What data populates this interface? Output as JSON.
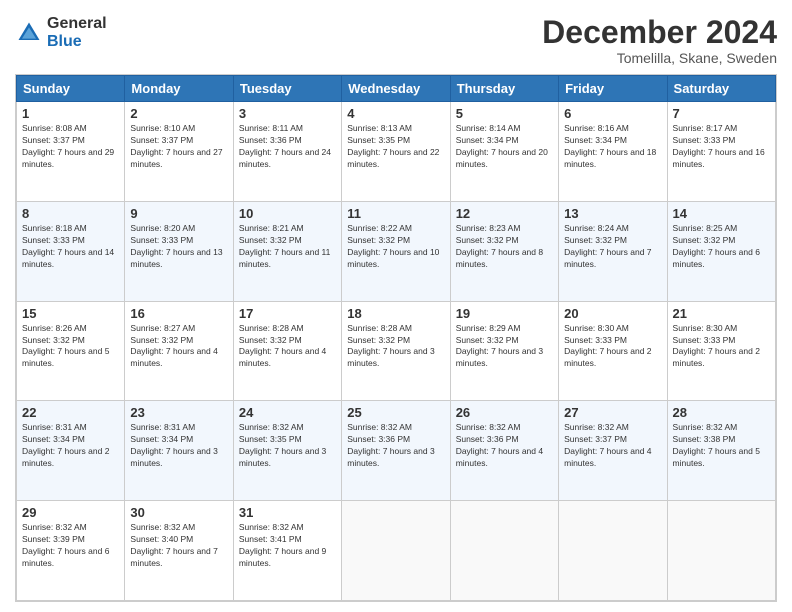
{
  "logo": {
    "general": "General",
    "blue": "Blue"
  },
  "title": "December 2024",
  "location": "Tomelilla, Skane, Sweden",
  "days_of_week": [
    "Sunday",
    "Monday",
    "Tuesday",
    "Wednesday",
    "Thursday",
    "Friday",
    "Saturday"
  ],
  "weeks": [
    [
      {
        "day": "1",
        "sunrise": "8:08 AM",
        "sunset": "3:37 PM",
        "daylight": "7 hours and 29 minutes."
      },
      {
        "day": "2",
        "sunrise": "8:10 AM",
        "sunset": "3:37 PM",
        "daylight": "7 hours and 27 minutes."
      },
      {
        "day": "3",
        "sunrise": "8:11 AM",
        "sunset": "3:36 PM",
        "daylight": "7 hours and 24 minutes."
      },
      {
        "day": "4",
        "sunrise": "8:13 AM",
        "sunset": "3:35 PM",
        "daylight": "7 hours and 22 minutes."
      },
      {
        "day": "5",
        "sunrise": "8:14 AM",
        "sunset": "3:34 PM",
        "daylight": "7 hours and 20 minutes."
      },
      {
        "day": "6",
        "sunrise": "8:16 AM",
        "sunset": "3:34 PM",
        "daylight": "7 hours and 18 minutes."
      },
      {
        "day": "7",
        "sunrise": "8:17 AM",
        "sunset": "3:33 PM",
        "daylight": "7 hours and 16 minutes."
      }
    ],
    [
      {
        "day": "8",
        "sunrise": "8:18 AM",
        "sunset": "3:33 PM",
        "daylight": "7 hours and 14 minutes."
      },
      {
        "day": "9",
        "sunrise": "8:20 AM",
        "sunset": "3:33 PM",
        "daylight": "7 hours and 13 minutes."
      },
      {
        "day": "10",
        "sunrise": "8:21 AM",
        "sunset": "3:32 PM",
        "daylight": "7 hours and 11 minutes."
      },
      {
        "day": "11",
        "sunrise": "8:22 AM",
        "sunset": "3:32 PM",
        "daylight": "7 hours and 10 minutes."
      },
      {
        "day": "12",
        "sunrise": "8:23 AM",
        "sunset": "3:32 PM",
        "daylight": "7 hours and 8 minutes."
      },
      {
        "day": "13",
        "sunrise": "8:24 AM",
        "sunset": "3:32 PM",
        "daylight": "7 hours and 7 minutes."
      },
      {
        "day": "14",
        "sunrise": "8:25 AM",
        "sunset": "3:32 PM",
        "daylight": "7 hours and 6 minutes."
      }
    ],
    [
      {
        "day": "15",
        "sunrise": "8:26 AM",
        "sunset": "3:32 PM",
        "daylight": "7 hours and 5 minutes."
      },
      {
        "day": "16",
        "sunrise": "8:27 AM",
        "sunset": "3:32 PM",
        "daylight": "7 hours and 4 minutes."
      },
      {
        "day": "17",
        "sunrise": "8:28 AM",
        "sunset": "3:32 PM",
        "daylight": "7 hours and 4 minutes."
      },
      {
        "day": "18",
        "sunrise": "8:28 AM",
        "sunset": "3:32 PM",
        "daylight": "7 hours and 3 minutes."
      },
      {
        "day": "19",
        "sunrise": "8:29 AM",
        "sunset": "3:32 PM",
        "daylight": "7 hours and 3 minutes."
      },
      {
        "day": "20",
        "sunrise": "8:30 AM",
        "sunset": "3:33 PM",
        "daylight": "7 hours and 2 minutes."
      },
      {
        "day": "21",
        "sunrise": "8:30 AM",
        "sunset": "3:33 PM",
        "daylight": "7 hours and 2 minutes."
      }
    ],
    [
      {
        "day": "22",
        "sunrise": "8:31 AM",
        "sunset": "3:34 PM",
        "daylight": "7 hours and 2 minutes."
      },
      {
        "day": "23",
        "sunrise": "8:31 AM",
        "sunset": "3:34 PM",
        "daylight": "7 hours and 3 minutes."
      },
      {
        "day": "24",
        "sunrise": "8:32 AM",
        "sunset": "3:35 PM",
        "daylight": "7 hours and 3 minutes."
      },
      {
        "day": "25",
        "sunrise": "8:32 AM",
        "sunset": "3:36 PM",
        "daylight": "7 hours and 3 minutes."
      },
      {
        "day": "26",
        "sunrise": "8:32 AM",
        "sunset": "3:36 PM",
        "daylight": "7 hours and 4 minutes."
      },
      {
        "day": "27",
        "sunrise": "8:32 AM",
        "sunset": "3:37 PM",
        "daylight": "7 hours and 4 minutes."
      },
      {
        "day": "28",
        "sunrise": "8:32 AM",
        "sunset": "3:38 PM",
        "daylight": "7 hours and 5 minutes."
      }
    ],
    [
      {
        "day": "29",
        "sunrise": "8:32 AM",
        "sunset": "3:39 PM",
        "daylight": "7 hours and 6 minutes."
      },
      {
        "day": "30",
        "sunrise": "8:32 AM",
        "sunset": "3:40 PM",
        "daylight": "7 hours and 7 minutes."
      },
      {
        "day": "31",
        "sunrise": "8:32 AM",
        "sunset": "3:41 PM",
        "daylight": "7 hours and 9 minutes."
      },
      null,
      null,
      null,
      null
    ]
  ]
}
